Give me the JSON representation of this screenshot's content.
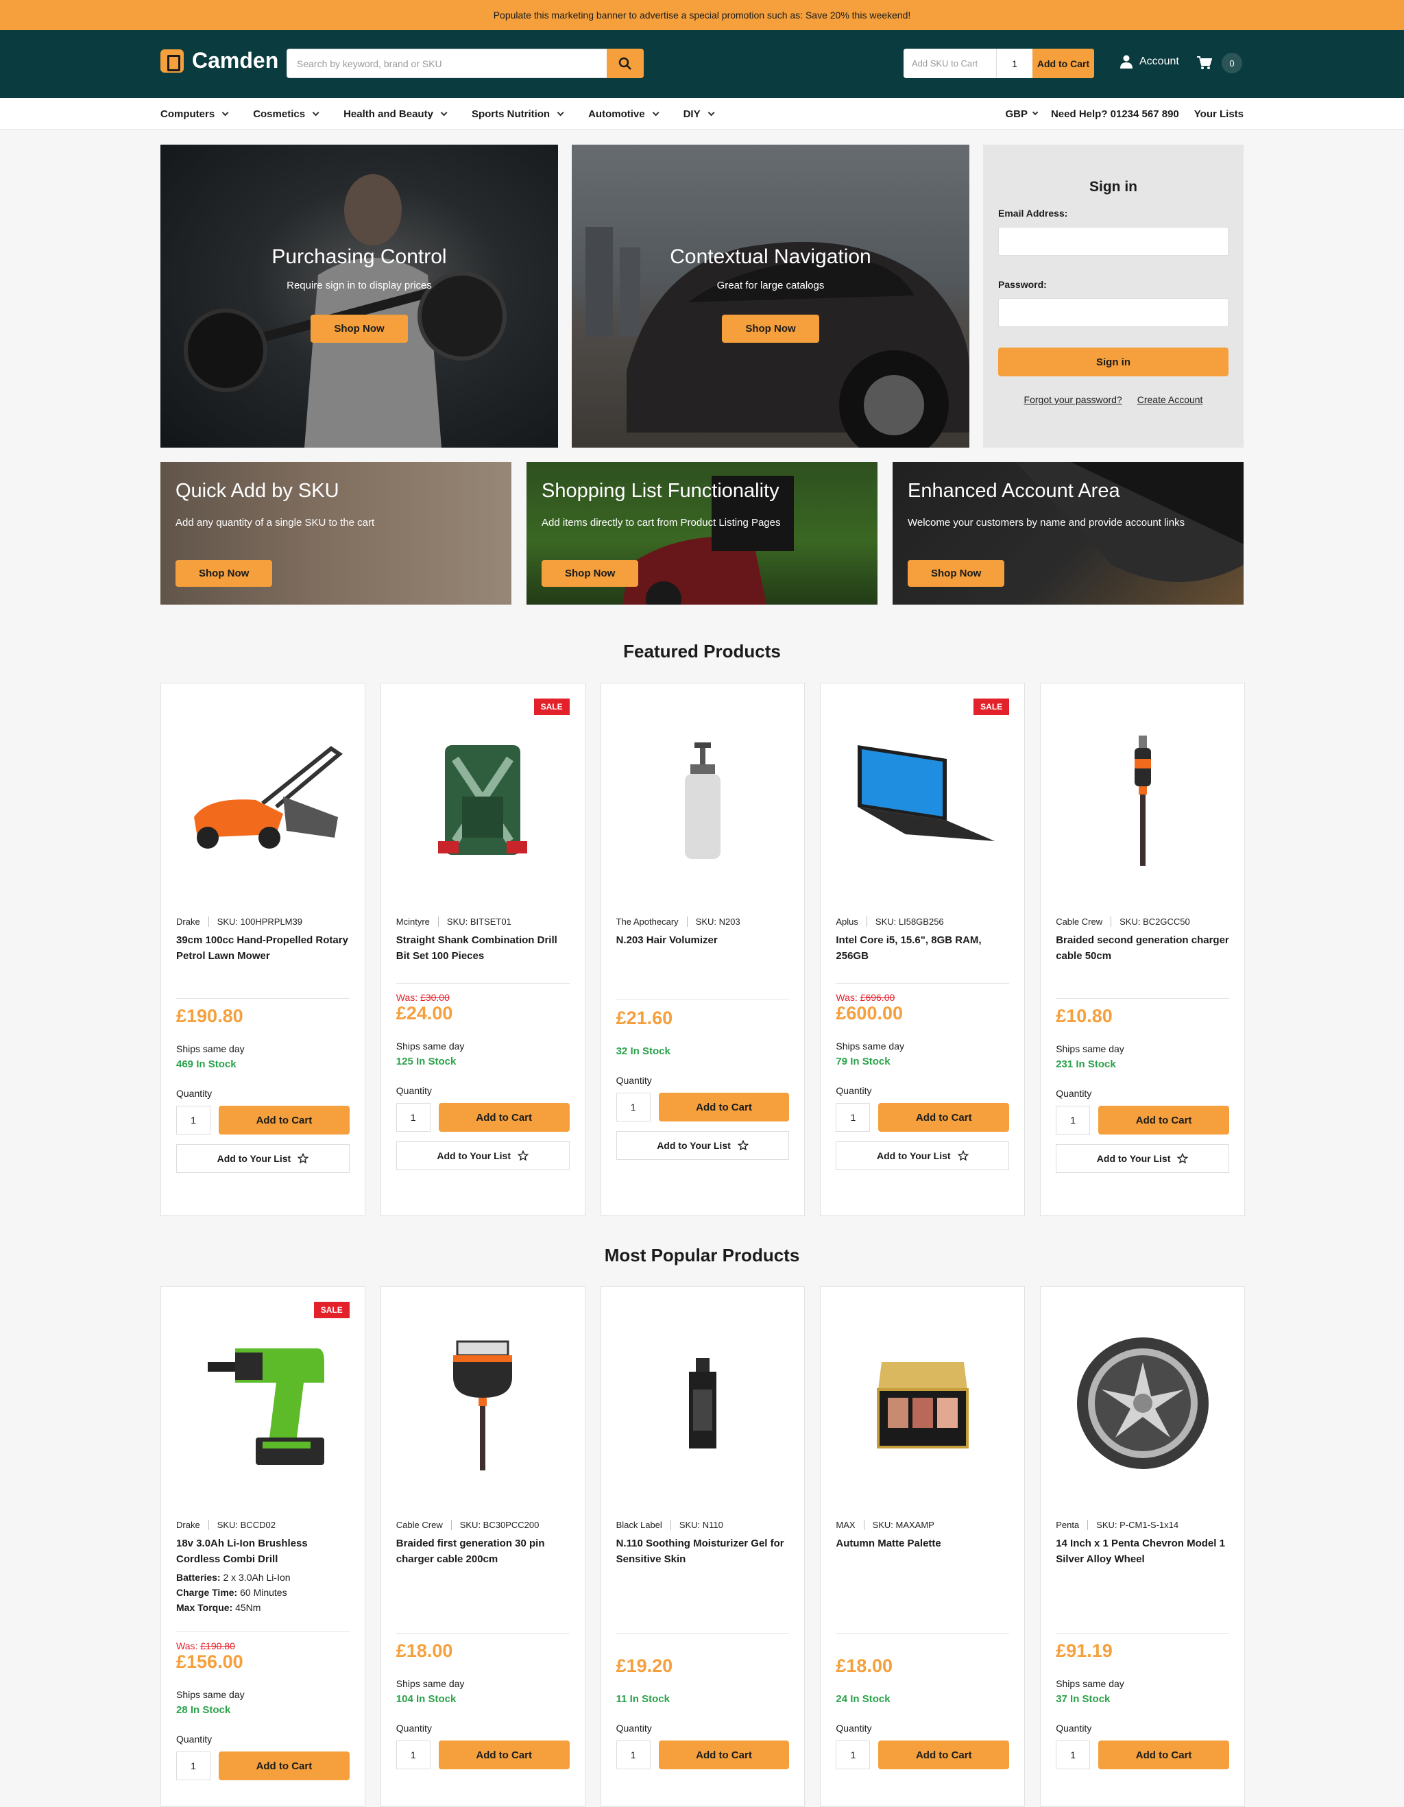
{
  "promo_banner": "Populate this marketing banner to advertise a special promotion such as: Save 20% this weekend!",
  "header": {
    "logo": "Camden",
    "search_placeholder": "Search by keyword, brand or SKU",
    "quick_add": {
      "sku_placeholder": "Add SKU to Cart",
      "qty": "1",
      "button": "Add to Cart"
    },
    "account": "Account",
    "cart_count": "0"
  },
  "nav": {
    "items": [
      "Computers",
      "Cosmetics",
      "Health and Beauty",
      "Sports Nutrition",
      "Automotive",
      "DIY"
    ],
    "currency": "GBP",
    "help": "Need Help? 01234 567 890",
    "lists": "Your Lists"
  },
  "hero": [
    {
      "title": "Purchasing Control",
      "subtitle": "Require sign in to display prices",
      "button": "Shop Now"
    },
    {
      "title": "Contextual Navigation",
      "subtitle": "Great for large catalogs",
      "button": "Shop Now"
    }
  ],
  "signin": {
    "title": "Sign in",
    "email_label": "Email Address:",
    "password_label": "Password:",
    "button": "Sign in",
    "forgot": "Forgot your password?",
    "create": "Create Account"
  },
  "promos": [
    {
      "title": "Quick Add by SKU",
      "subtitle": "Add any quantity of a single SKU to the cart",
      "button": "Shop Now"
    },
    {
      "title": "Shopping List Functionality",
      "subtitle": "Add items directly to cart from Product Listing Pages",
      "button": "Shop Now"
    },
    {
      "title": "Enhanced Account Area",
      "subtitle": "Welcome your customers by name and provide account links",
      "button": "Shop Now"
    }
  ],
  "featured": {
    "title": "Featured Products",
    "products": [
      {
        "brand": "Drake",
        "sku": "SKU: 100HPRPLM39",
        "name": "39cm 100cc Hand-Propelled Rotary Petrol Lawn Mower",
        "was": "",
        "price": "£190.80",
        "ships": "Ships same day",
        "stock": "469 In Stock",
        "sale": ""
      },
      {
        "brand": "Mcintyre",
        "sku": "SKU: BITSET01",
        "name": "Straight Shank Combination Drill Bit Set 100 Pieces",
        "was": "£30.00",
        "price": "£24.00",
        "ships": "Ships same day",
        "stock": "125 In Stock",
        "sale": "SALE"
      },
      {
        "brand": "The Apothecary",
        "sku": "SKU: N203",
        "name": "N.203 Hair Volumizer",
        "was": "",
        "price": "£21.60",
        "ships": "",
        "stock": "32 In Stock",
        "sale": ""
      },
      {
        "brand": "Aplus",
        "sku": "SKU: LI58GB256",
        "name": "Intel Core i5, 15.6\", 8GB RAM, 256GB",
        "was": "£696.00",
        "price": "£600.00",
        "ships": "Ships same day",
        "stock": "79 In Stock",
        "sale": "SALE"
      },
      {
        "brand": "Cable Crew",
        "sku": "SKU: BC2GCC50",
        "name": "Braided second generation charger cable 50cm",
        "was": "",
        "price": "£10.80",
        "ships": "Ships same day",
        "stock": "231 In Stock",
        "sale": ""
      }
    ]
  },
  "popular": {
    "title": "Most Popular Products",
    "products": [
      {
        "brand": "Drake",
        "sku": "SKU: BCCD02",
        "name": "18v 3.0Ah Li-Ion Brushless Cordless Combi Drill",
        "was": "£190.80",
        "price": "£156.00",
        "ships": "Ships same day",
        "stock": "28 In Stock",
        "sale": "SALE",
        "specs": [
          {
            "k": "Batteries:",
            "v": "2 x 3.0Ah Li-Ion"
          },
          {
            "k": "Charge Time:",
            "v": "60 Minutes"
          },
          {
            "k": "Max Torque:",
            "v": "45Nm"
          }
        ]
      },
      {
        "brand": "Cable Crew",
        "sku": "SKU: BC30PCC200",
        "name": "Braided first generation 30 pin charger cable 200cm",
        "was": "",
        "price": "£18.00",
        "ships": "Ships same day",
        "stock": "104 In Stock",
        "sale": ""
      },
      {
        "brand": "Black Label",
        "sku": "SKU: N110",
        "name": "N.110 Soothing Moisturizer Gel for Sensitive Skin",
        "was": "",
        "price": "£19.20",
        "ships": "",
        "stock": "11 In Stock",
        "sale": ""
      },
      {
        "brand": "MAX",
        "sku": "SKU: MAXAMP",
        "name": "Autumn Matte Palette",
        "was": "",
        "price": "£18.00",
        "ships": "",
        "stock": "24 In Stock",
        "sale": ""
      },
      {
        "brand": "Penta",
        "sku": "SKU: P-CM1-S-1x14",
        "name": "14 Inch x 1 Penta Chevron Model 1 Silver Alloy Wheel",
        "was": "",
        "price": "£91.19",
        "ships": "Ships same day",
        "stock": "37 In Stock",
        "sale": ""
      }
    ]
  },
  "card_labels": {
    "was": "Was:",
    "quantity": "Quantity",
    "qty": "1",
    "add_to_cart": "Add to Cart",
    "add_to_list": "Add to Your List"
  }
}
